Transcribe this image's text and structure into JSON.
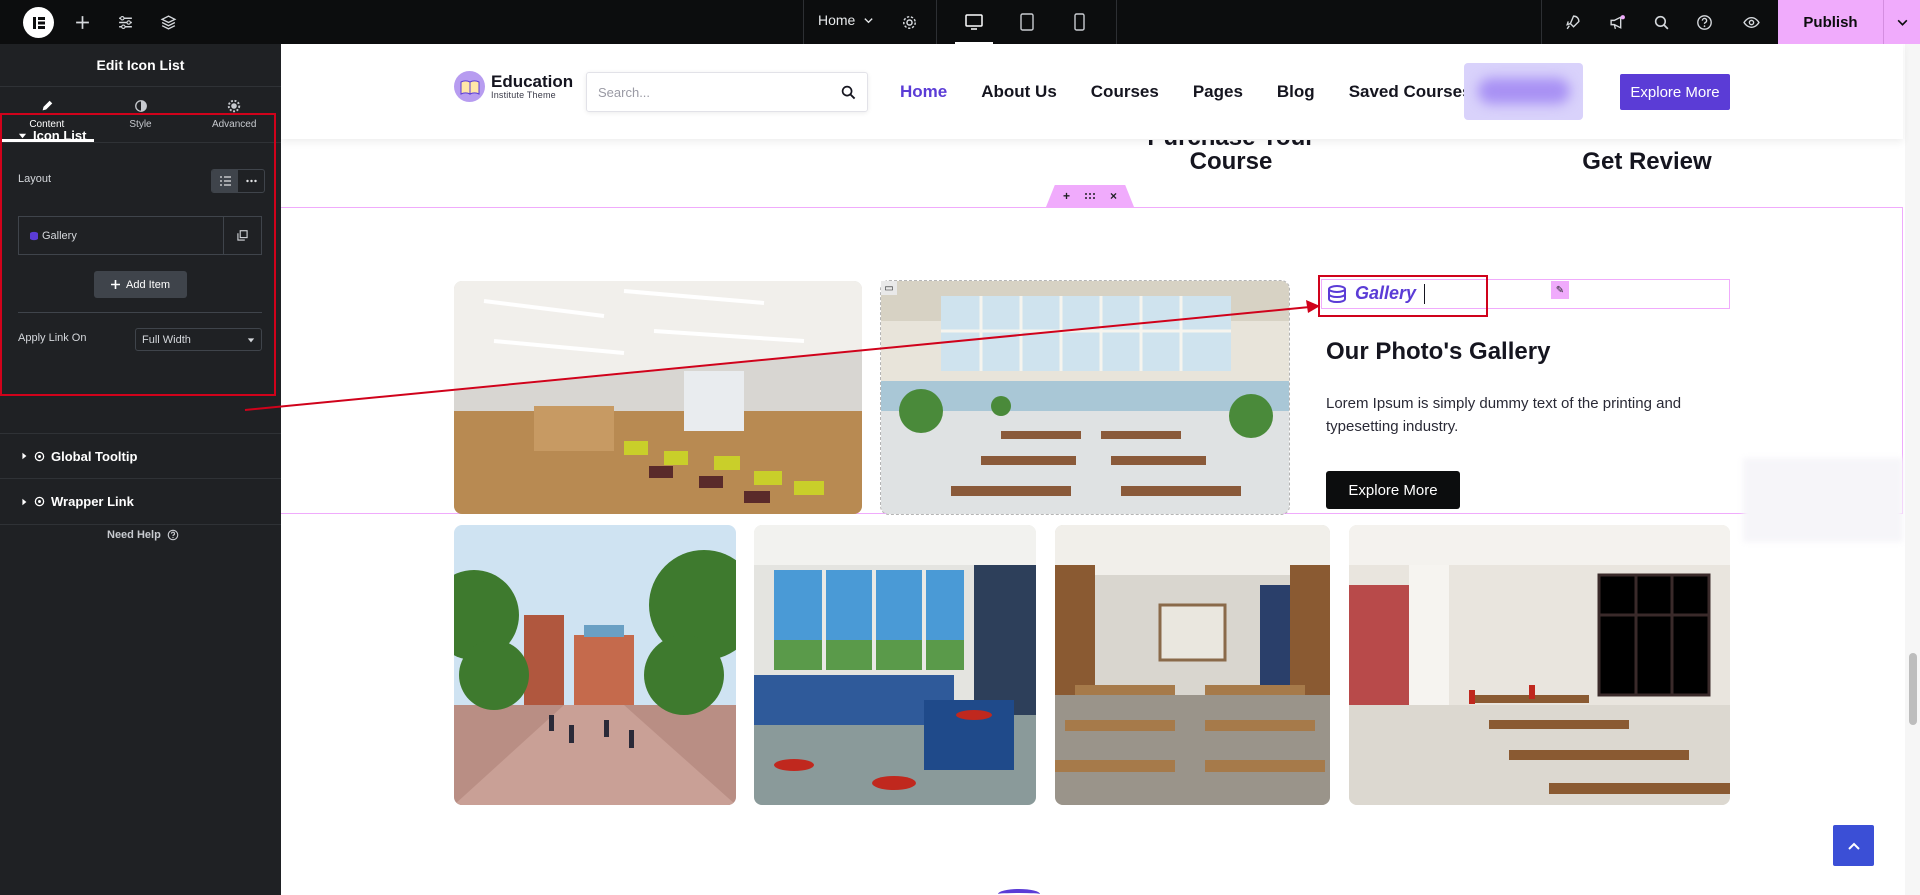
{
  "topbar": {
    "page_name": "Home",
    "publish_label": "Publish"
  },
  "panel": {
    "title": "Edit Icon List",
    "tabs": [
      {
        "label": "Content"
      },
      {
        "label": "Style"
      },
      {
        "label": "Advanced"
      }
    ],
    "section_icon_list": "Icon List",
    "layout_label": "Layout",
    "repeater_item": "Gallery",
    "add_item_label": "Add Item",
    "apply_link_label": "Apply Link On",
    "apply_link_value": "Full Width",
    "global_tooltip": "Global Tooltip",
    "wrapper_link": "Wrapper Link",
    "need_help": "Need Help"
  },
  "site": {
    "logo_name": "Education",
    "logo_sub": "Institute Theme",
    "search_placeholder": "Search...",
    "nav": [
      {
        "label": "Home"
      },
      {
        "label": "About Us"
      },
      {
        "label": "Courses"
      },
      {
        "label": "Pages"
      },
      {
        "label": "Blog"
      },
      {
        "label": "Saved Courses"
      }
    ],
    "explore_top": "Explore More",
    "step_1_line1": "Purchase Your",
    "step_1_line2": "Course",
    "step_2": "Get Review",
    "gallery_item": "Gallery",
    "gallery_heading": "Our Photo's Gallery",
    "gallery_text": "Lorem Ipsum is simply dummy text of the printing and typesetting industry.",
    "gallery_button": "Explore More"
  },
  "colors": {
    "accent": "#5b3cd6",
    "editor_pink": "#f0abfc",
    "annotation_red": "#d0021b",
    "panel_bg": "#1f2124"
  }
}
